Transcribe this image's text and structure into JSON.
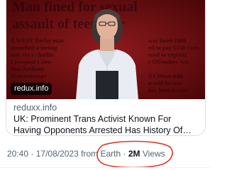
{
  "link_card": {
    "image": {
      "headline_lines": [
        "Man fined for sexual",
        "assault of teenager"
      ],
      "article_text_left": [
        "A WEST Derby man",
        "assaulted a teenag",
        "met via a chatlin",
        "Liverpool Crow",
        "that Anthony",
        "Wolverhampt",
        "after arrangi"
      ],
      "article_text_right": [
        "was fined £800",
        "ed to pay £150 costs",
        "ered to register",
        "s Offenders Act",
        "d Clifton told",
        "n told he was",
        "has been a case"
      ],
      "domain_badge": "redux.info"
    },
    "domain": "reduxx.info",
    "title": "UK: Prominent Trans Activist Known For Having Opponents Arrested Has History Of Indecent Ass..."
  },
  "meta": {
    "time": "20:40",
    "separator": "·",
    "date": "17/08/2023",
    "source_prefix": "from",
    "source": "Earth",
    "views_count": "2M",
    "views_label": "Views"
  },
  "colors": {
    "annotation_circle": "#d9382b",
    "meta_text": "#536471",
    "card_border": "#d9dee3",
    "image_background": "#6f0d10"
  }
}
